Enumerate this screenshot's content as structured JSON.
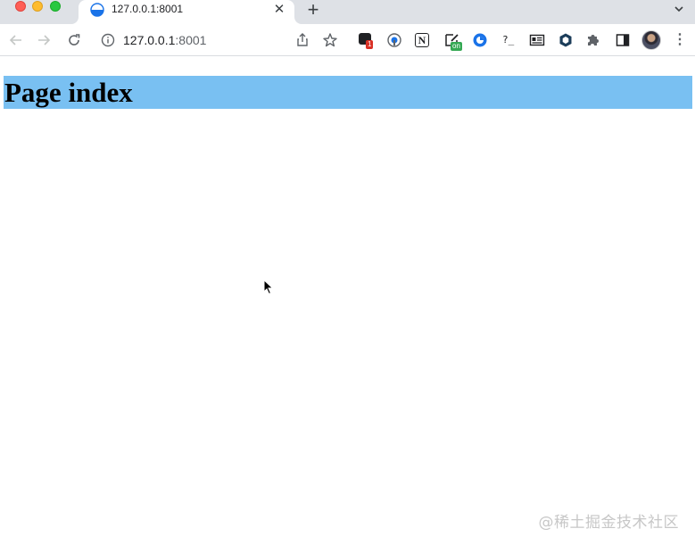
{
  "browser": {
    "tab": {
      "title": "127.0.0.1:8001",
      "favicon": "globe-half-blue-icon",
      "close_icon": "close-icon"
    },
    "new_tab_icon": "plus-icon",
    "tab_search_icon": "chevron-down-icon",
    "toolbar": {
      "back_icon": "arrow-left-icon",
      "forward_icon": "arrow-right-icon",
      "reload_icon": "reload-icon",
      "site_info_icon": "info-circle-icon",
      "address_host": "127.0.0.1",
      "address_port": ":8001",
      "share_icon": "share-icon",
      "bookmark_icon": "star-icon",
      "extensions": [
        {
          "name": "extension-badge-1",
          "badge": "1",
          "badge_color": "#d93025"
        },
        {
          "name": "extension-password"
        },
        {
          "name": "extension-notion",
          "glyph": "N"
        },
        {
          "name": "extension-edit-on",
          "badge": "on",
          "badge_color": "#34a853"
        },
        {
          "name": "extension-blue-circle"
        },
        {
          "name": "extension-terminal",
          "glyph": "?_"
        },
        {
          "name": "extension-reader"
        },
        {
          "name": "extension-hex"
        },
        {
          "name": "extensions-puzzle"
        },
        {
          "name": "side-panel"
        }
      ],
      "menu_icon": "kebab-menu-icon"
    }
  },
  "page": {
    "heading": "Page index",
    "heading_background": "#79c0f2"
  },
  "watermark": "@稀土掘金技术社区"
}
